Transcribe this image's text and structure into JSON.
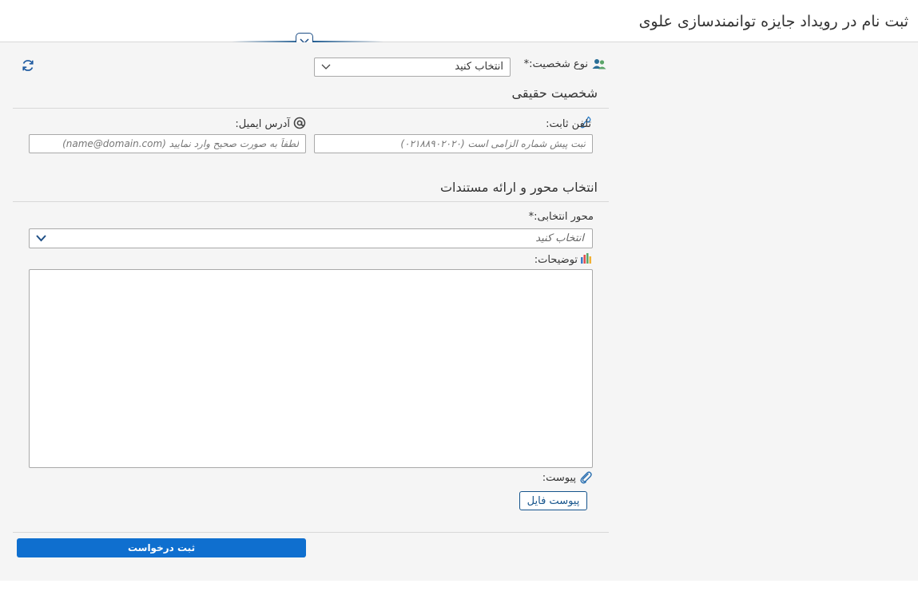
{
  "page": {
    "title": "ثبت نام در رویداد جایزه توانمندسازی علوی"
  },
  "person_type": {
    "label": "نوع شخصیت:*",
    "selected": "انتخاب کنید"
  },
  "section_individual": {
    "title": "شخصیت حقیقی"
  },
  "phone": {
    "label": "تلفن ثابت:",
    "placeholder": "ثبت پیش شماره الزامی است (۰۲۱۸۸۹۰۲۰۲۰)"
  },
  "email": {
    "label": "آدرس ایمیل:",
    "placeholder": "لطفاً به صورت صحیح وارد نمایید (name@domain.com)"
  },
  "section_axis": {
    "title": "انتخاب محور و ارائه مستندات"
  },
  "axis": {
    "label": "محور انتخابی:*",
    "selected": "انتخاب کنید"
  },
  "description": {
    "label": "توضیحات:"
  },
  "attachment": {
    "label": "پیوست:",
    "button": "پیوست فایل"
  },
  "submit": {
    "label": "ثبت درخواست"
  },
  "colors": {
    "primary": "#0f6fcf",
    "navy": "#15548c",
    "background": "#f5f5f5"
  },
  "icons": [
    "chevron-down-icon",
    "refresh-icon",
    "users-icon",
    "phone-icon",
    "at-icon",
    "chart-icon",
    "paperclip-icon"
  ]
}
